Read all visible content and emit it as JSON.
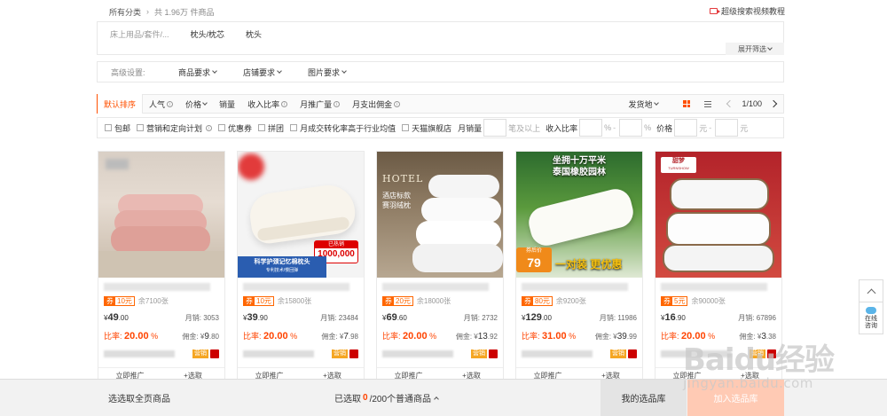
{
  "breadcrumb": {
    "root": "所有分类",
    "sep": "›",
    "count": "共 1.96万 件商品"
  },
  "tutorial": {
    "label": "超级搜索视频教程",
    "icon": "video-icon"
  },
  "category": {
    "path": "床上用品/套件/...",
    "items": [
      "枕头/枕芯",
      "枕头"
    ]
  },
  "expand": {
    "label": "展开筛选"
  },
  "advanced": {
    "label": "高级设置:",
    "dropdowns": [
      "商品要求",
      "店铺要求",
      "图片要求"
    ]
  },
  "sort": {
    "items": [
      {
        "label": "默认排序",
        "active": true
      },
      {
        "label": "人气",
        "info": true
      },
      {
        "label": "价格",
        "dropdown": true
      },
      {
        "label": "销量"
      },
      {
        "label": "收入比率",
        "info": true
      },
      {
        "label": "月推广量",
        "info": true
      },
      {
        "label": "月支出佣金",
        "info": true
      }
    ],
    "ship_from": "发货地",
    "page": "1/100"
  },
  "filters": {
    "checkboxes": [
      {
        "label": "包邮"
      },
      {
        "label": "营销和定向计划",
        "info": true
      },
      {
        "label": "优惠券"
      },
      {
        "label": "拼团"
      },
      {
        "label": "月成交转化率高于行业均值"
      },
      {
        "label": "天猫旗舰店"
      }
    ],
    "monthly_sales": {
      "label": "月销量",
      "unit": "笔及以上"
    },
    "income_ratio": {
      "label": "收入比率",
      "unit": "%",
      "dash": "-"
    },
    "price": {
      "label": "价格",
      "unit": "元",
      "dash": "-"
    }
  },
  "products": [
    {
      "coupon_label": "券",
      "coupon": "10元",
      "remain": "余7100张",
      "currency": "¥",
      "price_int": "49",
      "price_dec": ".00",
      "sales_label": "月销:",
      "sales": "3053",
      "rate_label": "比率:",
      "rate": "20.00",
      "rate_unit": "%",
      "comm_label": "佣金:",
      "comm_cur": "¥",
      "comm_int": "9",
      "comm_dec": ".80",
      "tag": "营销",
      "btn_promote": "立即推广",
      "btn_add": "+选取"
    },
    {
      "coupon_label": "券",
      "coupon": "10元",
      "remain": "余15800张",
      "currency": "¥",
      "price_int": "39",
      "price_dec": ".90",
      "sales_label": "月销:",
      "sales": "23484",
      "rate_label": "比率:",
      "rate": "20.00",
      "rate_unit": "%",
      "comm_label": "佣金:",
      "comm_cur": "¥",
      "comm_int": "7",
      "comm_dec": ".98",
      "tag": "营销",
      "btn_promote": "立即推广",
      "btn_add": "+选取",
      "banner": "科学护颈记忆棉枕头",
      "banner_sub": "专利技术/慢回弹",
      "sold_label": "已热销",
      "sold": "1000,000"
    },
    {
      "coupon_label": "券",
      "coupon": "20元",
      "remain": "余18000张",
      "currency": "¥",
      "price_int": "69",
      "price_dec": ".60",
      "sales_label": "月销:",
      "sales": "2732",
      "rate_label": "比率:",
      "rate": "20.00",
      "rate_unit": "%",
      "comm_label": "佣金:",
      "comm_cur": "¥",
      "comm_int": "13",
      "comm_dec": ".92",
      "tag": "营销",
      "btn_promote": "立即推广",
      "btn_add": "+选取",
      "hotel": "HOTEL",
      "hotel_title": "酒店标款",
      "hotel_sub": "赛羽绒枕"
    },
    {
      "coupon_label": "券",
      "coupon": "80元",
      "remain": "余9200张",
      "currency": "¥",
      "price_int": "129",
      "price_dec": ".00",
      "sales_label": "月销:",
      "sales": "11986",
      "rate_label": "比率:",
      "rate": "31.00",
      "rate_unit": "%",
      "comm_label": "佣金:",
      "comm_cur": "¥",
      "comm_int": "39",
      "comm_dec": ".99",
      "tag": "营销",
      "btn_promote": "立即推广",
      "btn_add": "+选取",
      "headline": "坐拥十万平米",
      "headline2": "泰国橡胶园林",
      "after_coupon": "券后价",
      "after_price": "79",
      "promo": "一对装 更优惠"
    },
    {
      "coupon_label": "券",
      "coupon": "5元",
      "remain": "余90000张",
      "currency": "¥",
      "price_int": "16",
      "price_dec": ".90",
      "sales_label": "月销:",
      "sales": "67896",
      "rate_label": "比率:",
      "rate": "20.00",
      "rate_unit": "%",
      "comm_label": "佣金:",
      "comm_cur": "¥",
      "comm_int": "3",
      "comm_dec": ".38",
      "tag": "营销",
      "btn_promote": "立即推广",
      "btn_add": "+选取",
      "brand": "甜梦",
      "brand_en": "TURNSHOW"
    }
  ],
  "bottom": {
    "select_all": "选选取全页商品",
    "selected_prefix": "已选取",
    "selected_num": "0",
    "selected_suffix": "/200个普通商品",
    "library": "我的选品库",
    "join": "加入选品库"
  },
  "side": {
    "chat_line1": "在线",
    "chat_line2": "咨询"
  },
  "watermark": {
    "main": "Baidu经验",
    "sub": "jingyan.baidu.com"
  },
  "colors": {
    "accent": "#ff5000",
    "price_red": "#f40",
    "coupon": "#f60"
  }
}
